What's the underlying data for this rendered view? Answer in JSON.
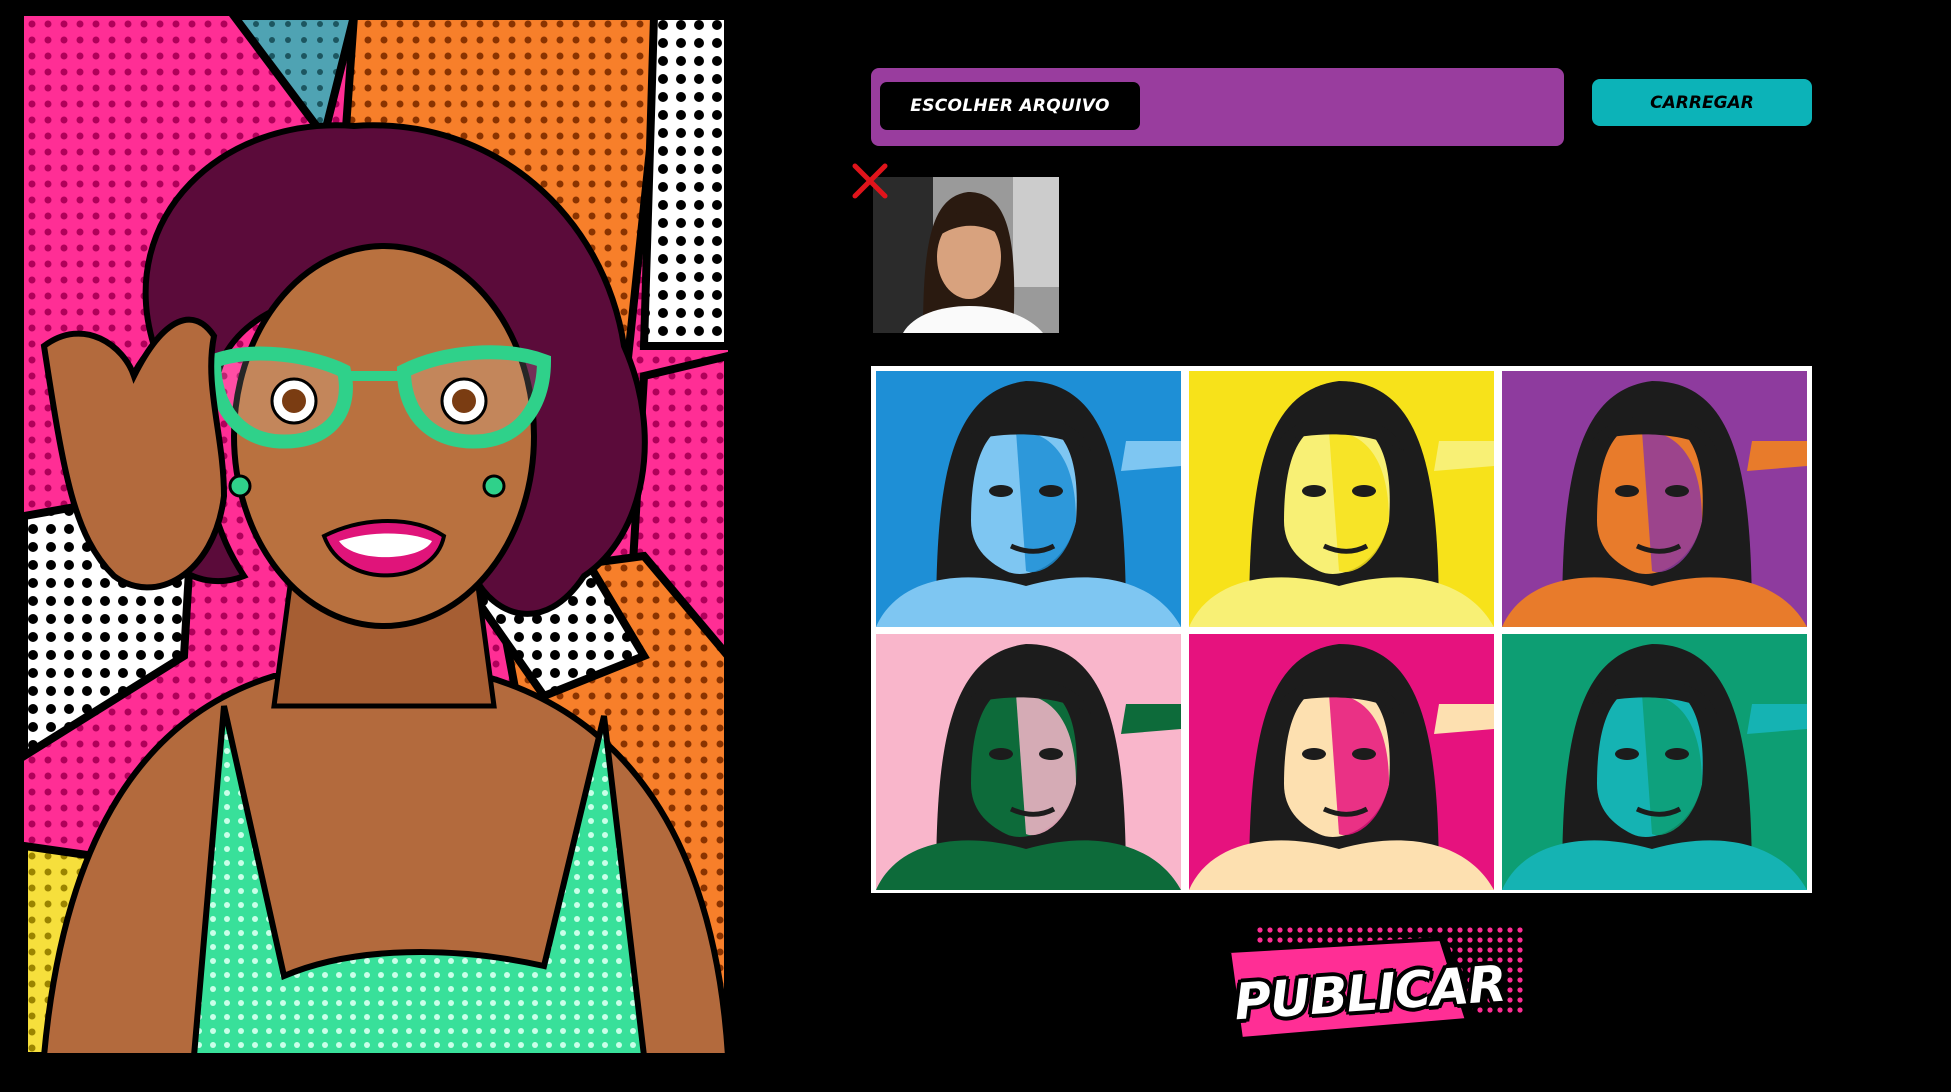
{
  "upload": {
    "choose_file_label": "ESCOLHER ARQUIVO",
    "upload_label": "CARREGAR"
  },
  "thumbnail": {
    "remove_icon": "close-icon"
  },
  "pop_grid": {
    "tiles": [
      {
        "bg": "#1e8fd6",
        "light": "#7ec6f2"
      },
      {
        "bg": "#f7e21a",
        "light": "#f8f075"
      },
      {
        "bg": "#8e3b9e",
        "light": "#e87b2b"
      },
      {
        "bg": "#f9b6cb",
        "light": "#0d6b3a"
      },
      {
        "bg": "#e6127e",
        "light": "#fde0b0"
      },
      {
        "bg": "#0d9e73",
        "light": "#15b3b3"
      }
    ]
  },
  "publish": {
    "label": "PUBLICAR"
  },
  "colors": {
    "background": "#000000",
    "file_bar": "#993d9e",
    "upload_button": "#0cb3b8",
    "remove_icon": "#e0141b",
    "publish_pink": "#ff2e95"
  }
}
